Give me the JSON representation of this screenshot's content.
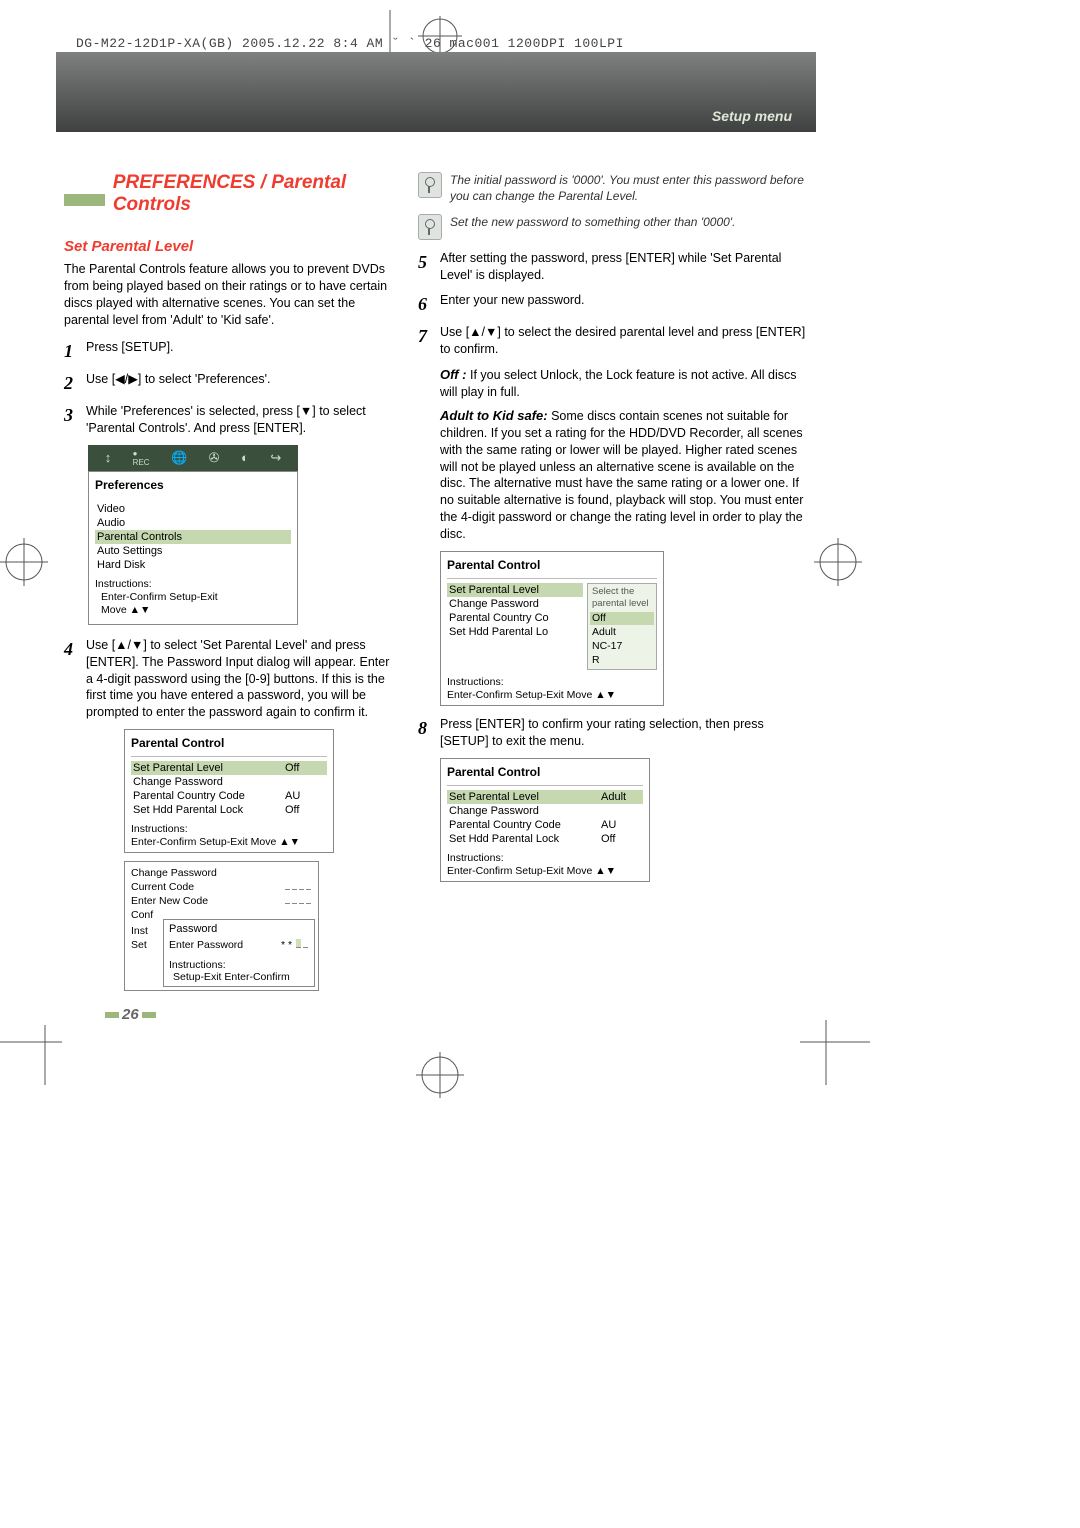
{
  "header_line": "DG-M22-12D1P-XA(GB)  2005.12.22 8:4 AM  ˘  `  26   mac001  1200DPI 100LPI",
  "banner": {
    "breadcrumb": "Setup menu"
  },
  "title": "PREFERENCES / Parental Controls",
  "subtitle": "Set Parental Level",
  "intro": "The Parental Controls feature allows you to prevent DVDs from being played based on their ratings or to have certain discs played with alternative scenes. You can set the parental level from 'Adult' to 'Kid safe'.",
  "left": {
    "s1": "Press [SETUP].",
    "s2": "Use [◀/▶] to select 'Preferences'.",
    "s3": "While 'Preferences' is selected, press [▼] to select 'Parental Controls'. And press [ENTER].",
    "s4": "Use [▲/▼] to select 'Set Parental Level' and press [ENTER].  The Password Input dialog will appear. Enter a 4-digit password using the [0-9] buttons. If this is the first time you have entered a password, you will be prompted to enter the password again to confirm it."
  },
  "prefs": {
    "title": "Preferences",
    "items": [
      "Video",
      "Audio",
      "Parental Controls",
      "Auto Settings",
      "Hard Disk"
    ],
    "selected_index": 2,
    "instr_label": "Instructions:",
    "instr_line1": "Enter-Confirm   Setup-Exit",
    "instr_line2": "Move ▲▼"
  },
  "pc_box1": {
    "title": "Parental Control",
    "rows": [
      {
        "k": "Set Parental Level",
        "v": "Off",
        "sel": true
      },
      {
        "k": "Change Password",
        "v": ""
      },
      {
        "k": "Parental Country Code",
        "v": "AU"
      },
      {
        "k": "Set Hdd Parental Lock",
        "v": "Off"
      }
    ],
    "instr_label": "Instructions:",
    "instr_line": "Enter-Confirm  Setup-Exit  Move ▲▼"
  },
  "pw_box": {
    "cp": "Change Password",
    "cc": "Current Code",
    "enc": "Enter New Code",
    "conf": "Conf",
    "inst": "Inst",
    "set": "Set",
    "popup_title": "Password",
    "popup_prompt": "Enter Password",
    "popup_instr_label": "Instructions:",
    "popup_instr": "Setup-Exit  Enter-Confirm"
  },
  "notes": {
    "n1": "The initial password is '0000'. You must enter this password before you can change the Parental Level.",
    "n2": "Set the new password to something other than '0000'."
  },
  "right": {
    "s5": "After setting the password, press [ENTER] while 'Set Parental Level' is displayed.",
    "s6": "Enter your new password.",
    "s7": "Use [▲/▼] to select the desired parental level and press [ENTER] to confirm.",
    "off_label": "Off :",
    "off_text": "If you select Unlock, the Lock feature is not active. All discs will play in full.",
    "aks_label": "Adult to Kid safe:",
    "aks_text": "Some discs contain scenes not suitable for children. If you set a rating for the HDD/DVD Recorder, all scenes with the same rating or lower will be played. Higher rated scenes will not be played unless an alternative scene is available on the disc. The alternative must have the same rating or a lower one. If no suitable alternative is found, playback will stop. You must enter the 4-digit password or change the rating level in order to play the disc.",
    "s8": "Press [ENTER] to confirm your rating selection, then press [SETUP] to exit the menu."
  },
  "pc_box2": {
    "title": "Parental Control",
    "rows": [
      {
        "k": "Set Parental Level",
        "v": "",
        "sel": true
      },
      {
        "k": "Change Password",
        "v": ""
      },
      {
        "k": "Parental Country Co",
        "v": ""
      },
      {
        "k": "Set Hdd Parental Lo",
        "v": ""
      }
    ],
    "dropdown_header": "Select the\nparental level",
    "dropdown": [
      "Off",
      "Adult",
      "NC-17",
      "R"
    ],
    "dd_sel_index": 0,
    "instr_label": "Instructions:",
    "instr_line": "Enter-Confirm  Setup-Exit  Move ▲▼"
  },
  "pc_box3": {
    "title": "Parental Control",
    "rows": [
      {
        "k": "Set Parental Level",
        "v": "Adult",
        "sel": true
      },
      {
        "k": "Change Password",
        "v": ""
      },
      {
        "k": "Parental Country Code",
        "v": "AU"
      },
      {
        "k": "Set Hdd Parental Lock",
        "v": "Off"
      }
    ],
    "instr_label": "Instructions:",
    "instr_line": "Enter-Confirm  Setup-Exit  Move ▲▼"
  },
  "page_number": "26"
}
